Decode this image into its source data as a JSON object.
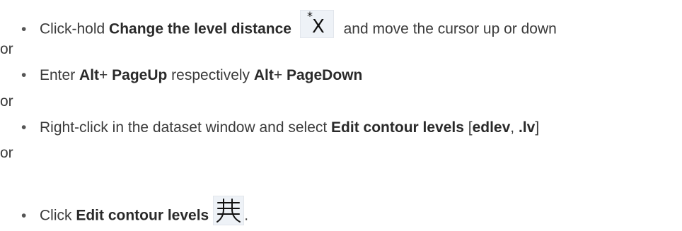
{
  "items": [
    {
      "bullet": "•",
      "prefix": "Click-hold ",
      "bold1": "Change the level distance",
      "suffix": " and move the cursor up or down"
    },
    {
      "sep": "or"
    },
    {
      "bullet": "•",
      "prefix": "Enter ",
      "bold1": "Alt",
      "plus1": "+ ",
      "bold2": "PageUp",
      "mid": " respectively ",
      "bold3": "Alt",
      "plus2": "+ ",
      "bold4": "PageDown"
    },
    {
      "sep": "or"
    },
    {
      "bullet": "•",
      "prefix": "Right-click in the dataset window and select ",
      "bold1": "Edit contour levels",
      "open": " [",
      "bold2": "edlev",
      "comma": ", ",
      "bold3": ".lv",
      "close": "]"
    },
    {
      "sep": "or"
    },
    {
      "bullet": "•",
      "prefix": "Click ",
      "bold1": "Edit contour levels",
      "end": "."
    }
  ],
  "icons": {
    "level_distance": {
      "name": "change-level-distance-icon",
      "glyph": "*X"
    },
    "contour": {
      "name": "edit-contour-levels-icon"
    }
  }
}
